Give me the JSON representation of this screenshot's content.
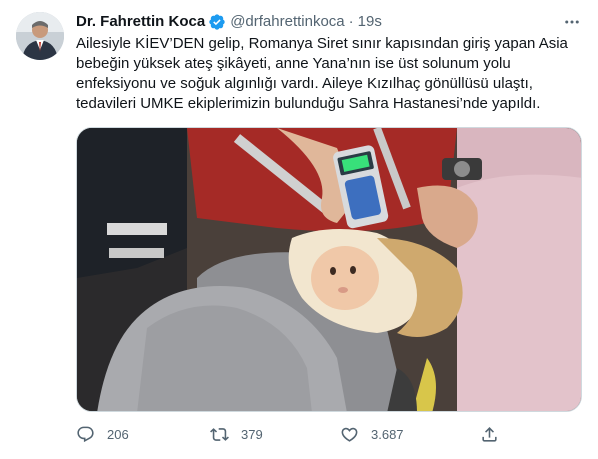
{
  "tweet": {
    "author_name": "Dr. Fahrettin Koca",
    "author_handle": "@drfahrettinkoca",
    "separator": "·",
    "time": "19s",
    "verified_icon": "verified-badge-icon",
    "more_icon": "more-dots-icon",
    "text_lines": [
      "Ailesiyle KİEV’DEN gelip, Romanya Siret sınır kapısından giriş yapan Asia",
      "bebeğin yüksek ateş şikâyeti, anne Yana’nın ise üst solunum yolu",
      "enfeksiyonu ve soğuk algınlığı vardı. Aileye Kızılhaç gönüllüsü ulaştı,",
      "tedavileri UMKE ekiplerimizin bulunduğu Sahra Hastanesi’nde yapıldı."
    ],
    "thermometer_display": "",
    "actions": {
      "reply_count": "206",
      "retweet_count": "379",
      "like_count": "3.687"
    }
  },
  "colors": {
    "text_primary": "#0f1419",
    "text_secondary": "#536471",
    "verified_blue": "#1d9bf0",
    "border": "#cfd9de"
  }
}
